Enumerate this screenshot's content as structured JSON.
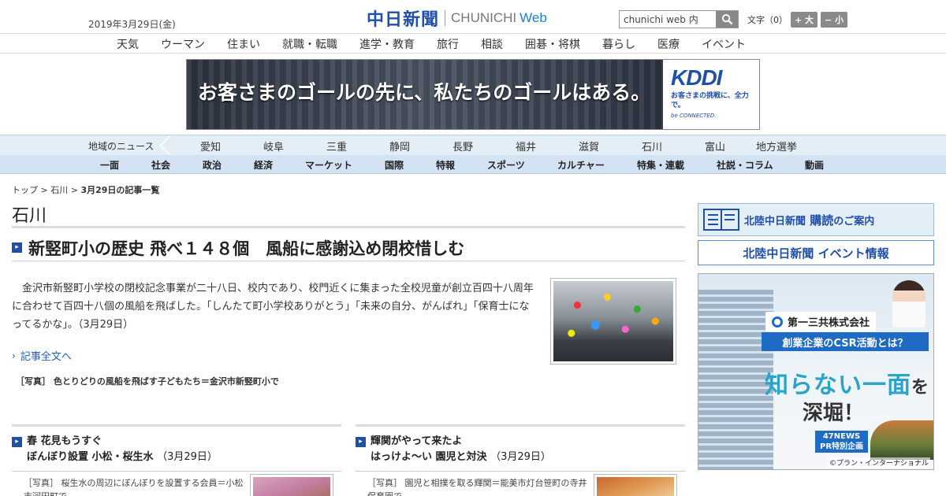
{
  "header": {
    "date": "2019年3月29日(金)",
    "logo_jp": "中日新聞",
    "logo_en": "CHUNICHI",
    "logo_web": "Web",
    "search_value": "chunichi web 内",
    "fontsize_label": "文字（0）",
    "fontsize_bigger": "+ 大",
    "fontsize_smaller": "− 小"
  },
  "topnav": [
    "天気",
    "ウーマン",
    "住まい",
    "就職・転職",
    "進学・教育",
    "旅行",
    "相談",
    "囲碁・将棋",
    "暮らし",
    "医療",
    "イベント"
  ],
  "ad_banner": {
    "copy": "お客さまのゴールの先に、私たちのゴールはある。",
    "brand": "KDDI",
    "tagline": "お客さまの挑戦に、全力で。",
    "sub": "be CONNECTED."
  },
  "regionnav": {
    "label": "地域のニュース",
    "items": [
      "愛知",
      "岐阜",
      "三重",
      "静岡",
      "長野",
      "福井",
      "滋賀",
      "石川",
      "富山",
      "地方選挙"
    ]
  },
  "catnav": [
    "一面",
    "社会",
    "政治",
    "経済",
    "マーケット",
    "国際",
    "特報",
    "スポーツ",
    "カルチャー",
    "特集・連載",
    "社説・コラム",
    "動画"
  ],
  "breadcrumb": {
    "top": "トップ",
    "sep": " > ",
    "region": "石川",
    "current": "3月29日の記事一覧"
  },
  "page_title": "石川",
  "main_article": {
    "headline": "新竪町小の歴史 飛べ１４８個　風船に感謝込め閉校惜しむ",
    "summary": "金沢市新竪町小学校の閉校記念事業が二十八日、校内であり、校門近くに集まった全校児童が創立百四十八周年に合わせて百四十八個の風船を飛ばした。「しんたて町小学校ありがとう」「未来の自分、がんばれ」「保育士になってるかな」。（3月29日）",
    "readmore": "記事全文へ",
    "caption": "［写真］ 色とりどりの風船を飛ばす子どもたち＝金沢市新竪町小で"
  },
  "sub_articles": [
    {
      "title_line1": "春 花見もうすぐ",
      "title_line2": "ぼんぼり設置 小松・桜生水",
      "date": "（3月29日）",
      "text": "［写真］ 桜生水の周辺にぼんぼりを設置する会員＝小松市河田町で"
    },
    {
      "title_line1": "輝関がやって来たよ",
      "title_line2": "はっけよ～い 園児と対決",
      "date": "（3月29日）",
      "text": "［写真］ 園児と相撲を取る輝関＝能美市灯台笹町の寺井保育園で"
    }
  ],
  "sidebar": {
    "banner1_main": "北陸中日新聞",
    "banner1_rest": "購読",
    "banner1_suffix": "のご案内",
    "banner2": "北陸中日新聞 イベント情報",
    "ad": {
      "company": "第一三共株式会社",
      "csr": "創業企業のCSR活動とは？",
      "big1": "知らない一面",
      "big1_suffix": "を",
      "big2": "深堀！",
      "pr_line1": "47NEWS",
      "pr_line2": "PR特別企画",
      "credit": "©プラン・インターナショナル"
    }
  },
  "colors": {
    "brand_blue": "#1f4fa6",
    "link_blue": "#1f5fb0",
    "nav_light": "#e4eef7",
    "nav_mid": "#d3e3f3"
  }
}
